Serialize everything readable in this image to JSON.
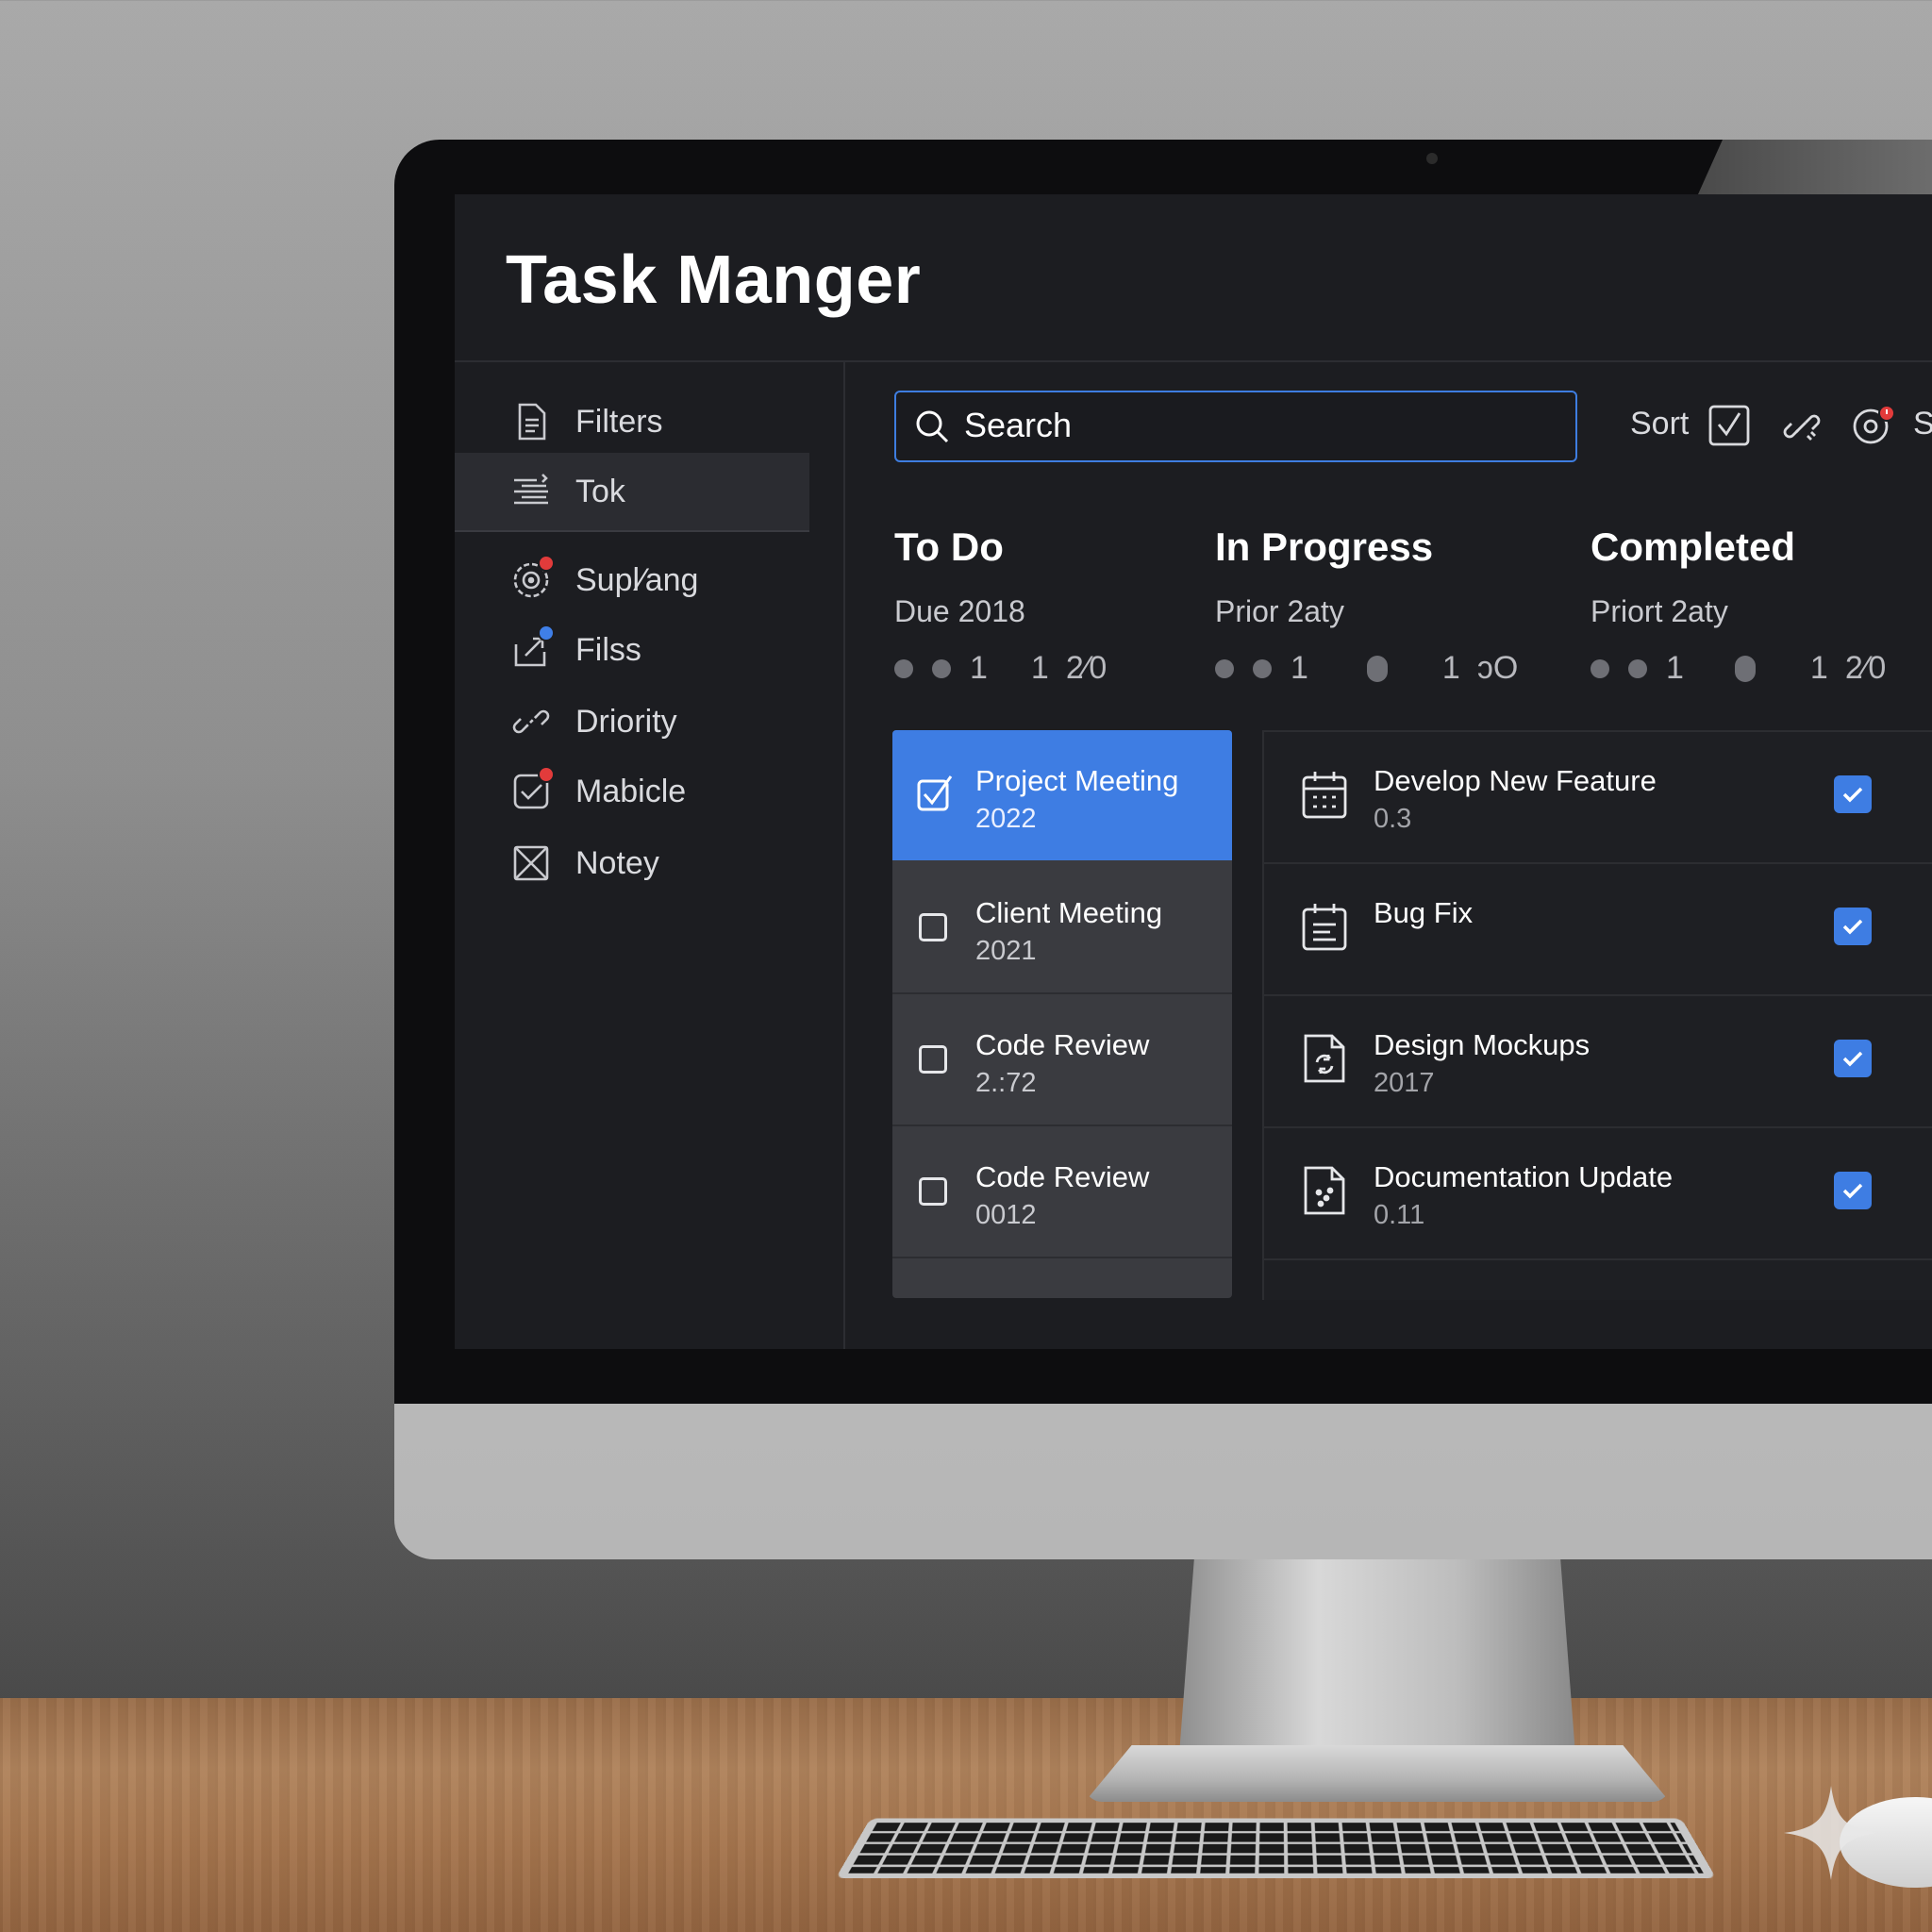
{
  "app": {
    "title": "Task Manger"
  },
  "sidebar": {
    "items": [
      {
        "label": "Filters",
        "icon": "document-icon"
      },
      {
        "label": "Tok",
        "icon": "list-icon",
        "active": true
      },
      {
        "label": "Supl⁄ang",
        "icon": "target-icon",
        "badge": "red"
      },
      {
        "label": "Filss",
        "icon": "share-box-icon",
        "badge": "blue"
      },
      {
        "label": "Driority",
        "icon": "link-icon"
      },
      {
        "label": "Mabicle",
        "icon": "check-square-icon",
        "badge": "red"
      },
      {
        "label": "Notey",
        "icon": "x-square-icon"
      }
    ]
  },
  "toolbar": {
    "search_placeholder": "Search",
    "sort_label": "Sort",
    "cutoff_label": "S"
  },
  "columns": [
    {
      "title": "To Do",
      "subtitle": "Due 2018",
      "meta": [
        "1",
        "1",
        "2⁄0"
      ]
    },
    {
      "title": "In Progress",
      "subtitle": "Prior 2aty",
      "meta": [
        "1",
        "1",
        "ɔO"
      ]
    },
    {
      "title": "Completed",
      "subtitle": "Priort 2aty",
      "meta": [
        "1",
        "1",
        "2⁄0"
      ]
    }
  ],
  "todo": [
    {
      "title": "Project Meeting",
      "sub": "2022",
      "checked": true
    },
    {
      "title": "Client Meeting",
      "sub": "2021",
      "checked": false
    },
    {
      "title": "Code Review",
      "sub": "2.:72",
      "checked": false
    },
    {
      "title": "Code Review",
      "sub": "0012",
      "checked": false
    }
  ],
  "completed": [
    {
      "title": "Develop New Feature",
      "sub": "0.3",
      "icon": "calendar-grid-icon"
    },
    {
      "title": "Bug Fix",
      "sub": "",
      "icon": "calendar-list-icon"
    },
    {
      "title": "Design Mockups",
      "sub": "2017",
      "icon": "file-refresh-icon"
    },
    {
      "title": "Documentation Update",
      "sub": "0.11",
      "icon": "file-dots-icon"
    }
  ],
  "colors": {
    "accent": "#3e7de3",
    "panel": "#1c1d21",
    "badge_red": "#e23b3b"
  }
}
